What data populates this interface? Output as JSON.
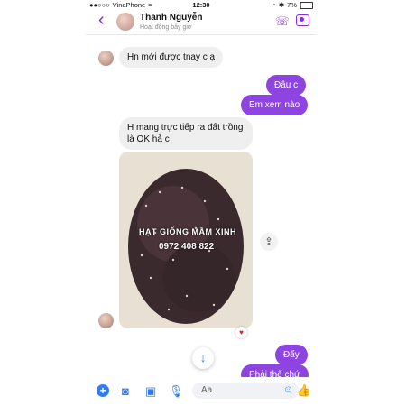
{
  "status_bar": {
    "carrier": "VinaPhone",
    "time": "12:30",
    "battery": "7%",
    "battery_level": 0.07
  },
  "header": {
    "name": "Thanh Nguyễn",
    "status": "Hoạt động bây giờ"
  },
  "messages": {
    "m1": "Hn mới được tnay c ạ",
    "m2": "Đâu c",
    "m3": "Em xem nào",
    "m4": "H mang trực tiếp ra đất trồng là OK hả c",
    "m5": "Đấy",
    "m6": "Phải thế chứ"
  },
  "photo": {
    "overlay_line1": "HẠT GIỐNG MẦM XINH",
    "overlay_line2": "0972 408 822"
  },
  "composer": {
    "placeholder": "Aa"
  },
  "icons": {
    "back": "chevron-left-icon",
    "call": "phone-icon",
    "video": "video-camera-icon",
    "share": "share-icon",
    "reaction": "heart-icon",
    "scroll": "arrow-down-icon",
    "add": "plus-icon",
    "camera": "camera-icon",
    "gallery": "image-icon",
    "mic": "microphone-icon",
    "emoji": "emoji-icon",
    "like": "thumbs-up-icon"
  },
  "colors": {
    "accent": "#8e44e0",
    "link_blue": "#2f7cf6"
  }
}
